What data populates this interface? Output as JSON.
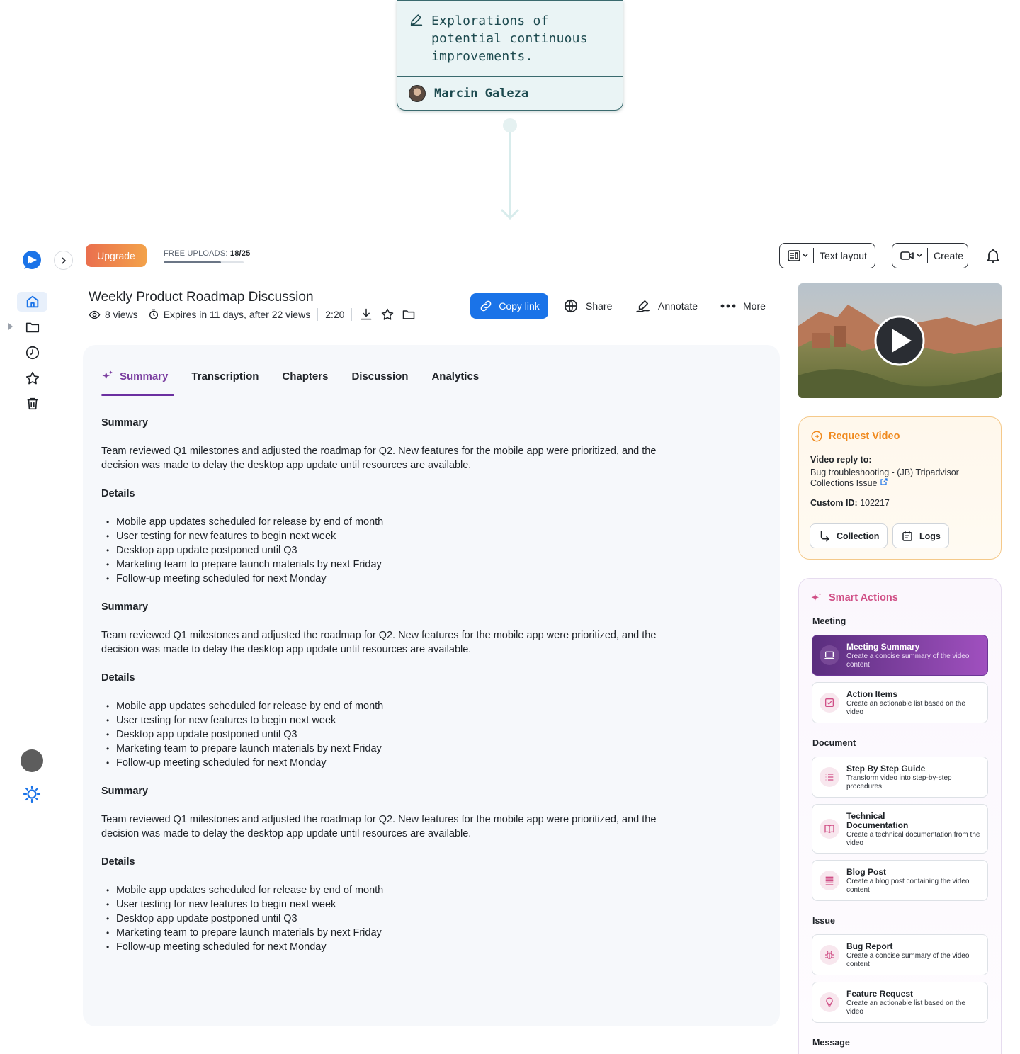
{
  "note": {
    "text": "Explorations of\npotential continuous\nimprovements.",
    "author": "Marcin Galeza"
  },
  "topbar": {
    "upgrade_label": "Upgrade",
    "uploads_label": "FREE UPLOADS:",
    "uploads_value": "18/25",
    "uploads_fraction": 0.72,
    "text_layout_label": "Text layout",
    "create_label": "Create"
  },
  "video": {
    "title": "Weekly Product Roadmap Discussion",
    "views": "8 views",
    "expires": "Expires in 11 days, after 22 views",
    "duration": "2:20"
  },
  "actions": {
    "copy_link": "Copy link",
    "share": "Share",
    "annotate": "Annotate",
    "more": "More"
  },
  "tabs": [
    "Summary",
    "Transcription",
    "Chapters",
    "Discussion",
    "Analytics"
  ],
  "sections": [
    {
      "summary_heading": "Summary",
      "summary_text": "Team reviewed Q1 milestones and adjusted the roadmap for Q2. New features for the mobile app were prioritized, and the decision was made to delay the desktop app update until resources are available.",
      "details_heading": "Details",
      "details": [
        "Mobile app updates scheduled for release by end of month",
        "User testing for new features to begin next week",
        "Desktop app update postponed until Q3",
        "Marketing team to prepare launch materials by next Friday",
        "Follow-up meeting scheduled for next Monday"
      ]
    },
    {
      "summary_heading": "Summary",
      "summary_text": "Team reviewed Q1 milestones and adjusted the roadmap for Q2. New features for the mobile app were prioritized, and the decision was made to delay the desktop app update until resources are available.",
      "details_heading": "Details",
      "details": [
        "Mobile app updates scheduled for release by end of month",
        "User testing for new features to begin next week",
        "Desktop app update postponed until Q3",
        "Marketing team to prepare launch materials by next Friday",
        "Follow-up meeting scheduled for next Monday"
      ]
    },
    {
      "summary_heading": "Summary",
      "summary_text": "Team reviewed Q1 milestones and adjusted the roadmap for Q2. New features for the mobile app were prioritized, and the decision was made to delay the desktop app update until resources are available.",
      "details_heading": "Details",
      "details": [
        "Mobile app updates scheduled for release by end of month",
        "User testing for new features to begin next week",
        "Desktop app update postponed until Q3",
        "Marketing team to prepare launch materials by next Friday",
        "Follow-up meeting scheduled for next Monday"
      ]
    }
  ],
  "request_video": {
    "title": "Request Video",
    "reply_label": "Video reply to:",
    "reply_value": "Bug troubleshooting - (JB) Tripadvisor Collections Issue",
    "custom_id_label": "Custom ID:",
    "custom_id_value": "102217",
    "collection_label": "Collection",
    "logs_label": "Logs"
  },
  "smart_actions": {
    "title": "Smart Actions",
    "meeting_label": "Meeting",
    "document_label": "Document",
    "issue_label": "Issue",
    "message_label": "Message",
    "items": [
      {
        "name": "Meeting Summary",
        "desc": "Create a concise summary of the video content",
        "icon": "laptop-icon"
      },
      {
        "name": "Action Items",
        "desc": "Create an actionable list based on the video",
        "icon": "checklist-icon"
      },
      {
        "name": "Step By Step Guide",
        "desc": "Transform video into step-by-step procedures",
        "icon": "list-icon"
      },
      {
        "name": "Technical Documentation",
        "desc": "Create a technical documentation from the video",
        "icon": "book-icon"
      },
      {
        "name": "Blog Post",
        "desc": "Create a blog post containing the video content",
        "icon": "article-icon"
      },
      {
        "name": "Bug Report",
        "desc": "Create a concise summary of the video content",
        "icon": "bug-icon"
      },
      {
        "name": "Feature Request",
        "desc": "Create an actionable list based on the video",
        "icon": "lightbulb-icon"
      }
    ]
  },
  "colors": {
    "accent": "#1a73e8",
    "purple": "#6b2fa0",
    "orange": "#f08a1e",
    "pink": "#d04f86"
  }
}
